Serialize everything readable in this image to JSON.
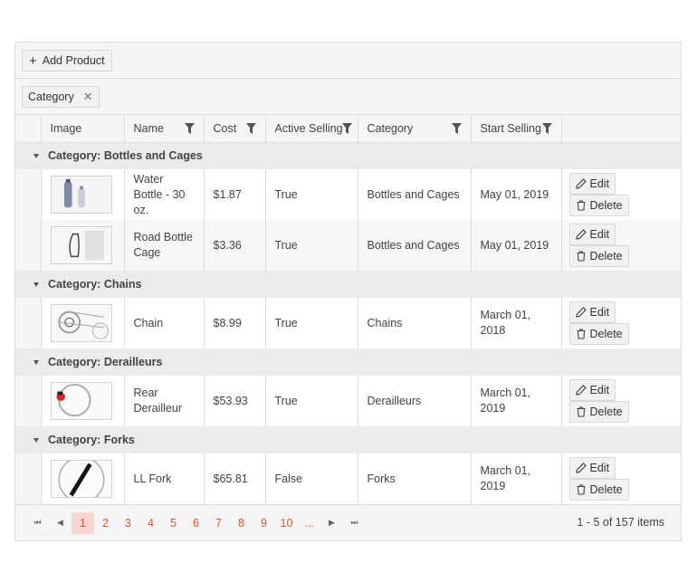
{
  "toolbar": {
    "add_label": "Add Product"
  },
  "group_chip": {
    "label": "Category"
  },
  "columns": [
    "Image",
    "Name",
    "Cost",
    "Active Selling",
    "Category",
    "Start Selling"
  ],
  "groups": [
    {
      "label": "Category: Bottles and Cages"
    },
    {
      "label": "Category: Chains"
    },
    {
      "label": "Category: Derailleurs"
    },
    {
      "label": "Category: Forks"
    }
  ],
  "rows": [
    {
      "name": "Water Bottle - 30 oz.",
      "cost": "$1.87",
      "active": "True",
      "category": "Bottles and Cages",
      "start": "May 01, 2019"
    },
    {
      "name": "Road Bottle Cage",
      "cost": "$3.36",
      "active": "True",
      "category": "Bottles and Cages",
      "start": "May 01, 2019"
    },
    {
      "name": "Chain",
      "cost": "$8.99",
      "active": "True",
      "category": "Chains",
      "start": "March 01, 2018"
    },
    {
      "name": "Rear Derailleur",
      "cost": "$53.93",
      "active": "True",
      "category": "Derailleurs",
      "start": "March 01, 2019"
    },
    {
      "name": "LL Fork",
      "cost": "$65.81",
      "active": "False",
      "category": "Forks",
      "start": "March 01, 2019"
    }
  ],
  "commands": {
    "edit": "Edit",
    "delete": "Delete"
  },
  "pager": {
    "pages": [
      "1",
      "2",
      "3",
      "4",
      "5",
      "6",
      "7",
      "8",
      "9",
      "10",
      "..."
    ],
    "current": "1",
    "info": "1 - 5 of 157 items"
  },
  "colors": {
    "accent": "#e94e2f",
    "selected_page_bg": "#f8d5cf"
  }
}
